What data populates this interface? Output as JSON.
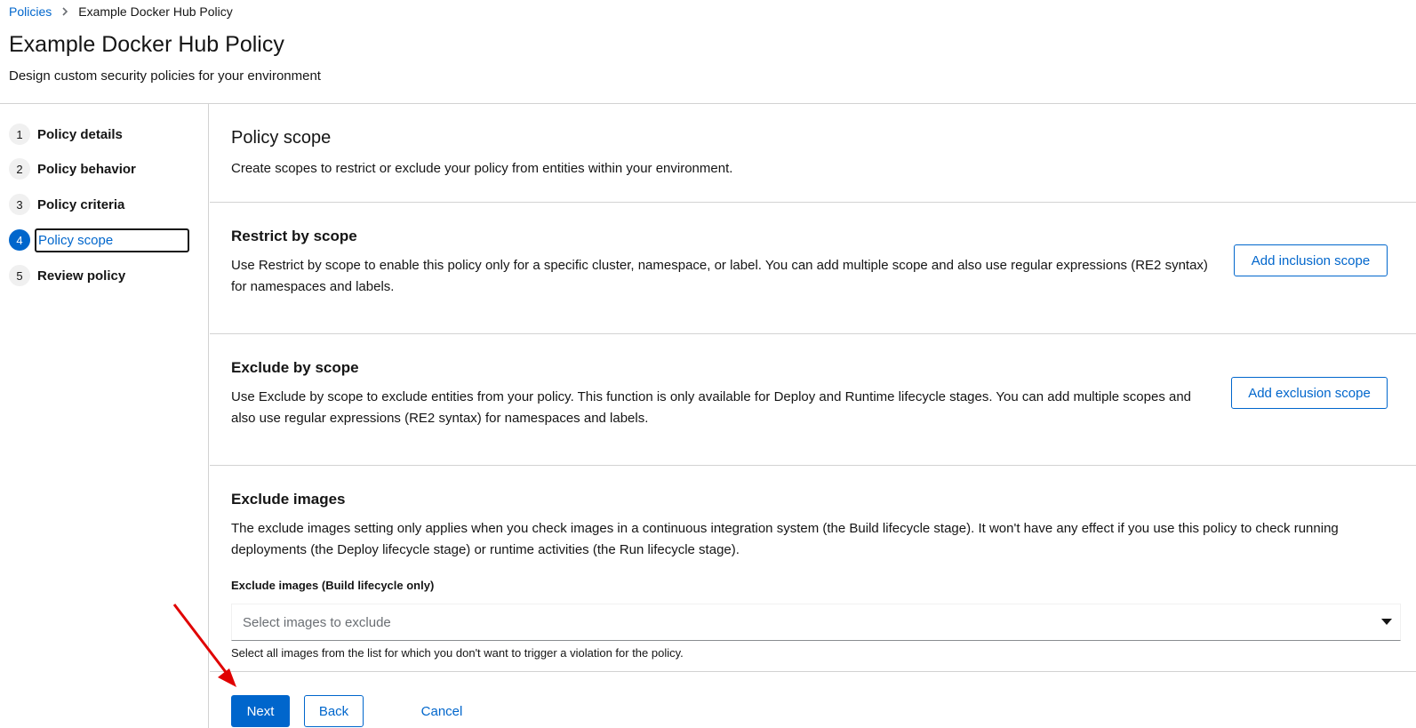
{
  "breadcrumb": {
    "parent": "Policies",
    "current": "Example Docker Hub Policy"
  },
  "header": {
    "title": "Example Docker Hub Policy",
    "subtitle": "Design custom security policies for your environment"
  },
  "wizard_nav": {
    "steps": [
      {
        "num": "1",
        "label": "Policy details"
      },
      {
        "num": "2",
        "label": "Policy behavior"
      },
      {
        "num": "3",
        "label": "Policy criteria"
      },
      {
        "num": "4",
        "label": "Policy scope",
        "active": true
      },
      {
        "num": "5",
        "label": "Review policy"
      }
    ]
  },
  "main": {
    "title": "Policy scope",
    "description": "Create scopes to restrict or exclude your policy from entities within your environment.",
    "restrict": {
      "title": "Restrict by scope",
      "description": "Use Restrict by scope to enable this policy only for a specific cluster, namespace, or label. You can add multiple scope and also use regular expressions (RE2 syntax) for namespaces and labels.",
      "button": "Add inclusion scope"
    },
    "exclude": {
      "title": "Exclude by scope",
      "description": "Use Exclude by scope to exclude entities from your policy. This function is only available for Deploy and Runtime lifecycle stages. You can add multiple scopes and also use regular expressions (RE2 syntax) for namespaces and labels.",
      "button": "Add exclusion scope"
    },
    "exclude_images": {
      "title": "Exclude images",
      "description": "The exclude images setting only applies when you check images in a continuous integration system (the Build lifecycle stage). It won't have any effect if you use this policy to check running deployments (the Deploy lifecycle stage) or runtime activities (the Run lifecycle stage).",
      "field_label": "Exclude images (Build lifecycle only)",
      "placeholder": "Select images to exclude",
      "helper": "Select all images from the list for which you don't want to trigger a violation for the policy."
    }
  },
  "footer": {
    "next": "Next",
    "back": "Back",
    "cancel": "Cancel"
  },
  "colors": {
    "accent": "#0066cc",
    "annotation_arrow": "#e00000"
  },
  "icons": {
    "breadcrumb_separator": "chevron-right-icon",
    "select_toggle": "caret-down-icon"
  }
}
